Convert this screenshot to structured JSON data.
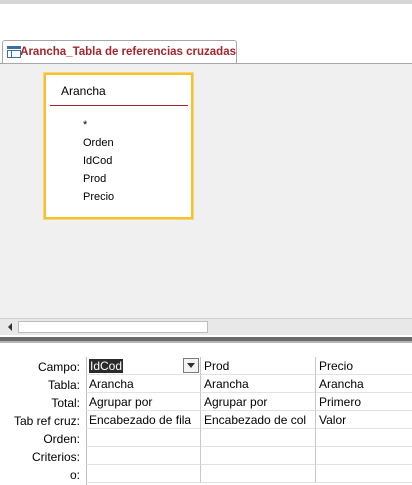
{
  "tab": {
    "label": "Arancha_Tabla de referencias cruzadas",
    "icon": "crosstab-query-icon"
  },
  "field_list": {
    "title": "Arancha",
    "fields": [
      "*",
      "Orden",
      "IdCod",
      "Prod",
      "Precio"
    ]
  },
  "grid": {
    "row_labels": [
      "Campo:",
      "Tabla:",
      "Total:",
      "Tab ref cruz:",
      "Orden:",
      "Criterios:",
      "o:"
    ],
    "columns": [
      {
        "campo": "IdCod",
        "tabla": "Arancha",
        "total": "Agrupar por",
        "tabref": "Encabezado de fila",
        "orden": "",
        "criterios": "",
        "o": ""
      },
      {
        "campo": "Prod",
        "tabla": "Arancha",
        "total": "Agrupar por",
        "tabref": "Encabezado de col",
        "orden": "",
        "criterios": "",
        "o": ""
      },
      {
        "campo": "Precio",
        "tabla": "Arancha",
        "total": "Primero",
        "tabref": "Valor",
        "orden": "",
        "criterios": "",
        "o": ""
      }
    ]
  },
  "colors": {
    "accent": "#a4262c",
    "selection_border": "#f7c02f"
  }
}
